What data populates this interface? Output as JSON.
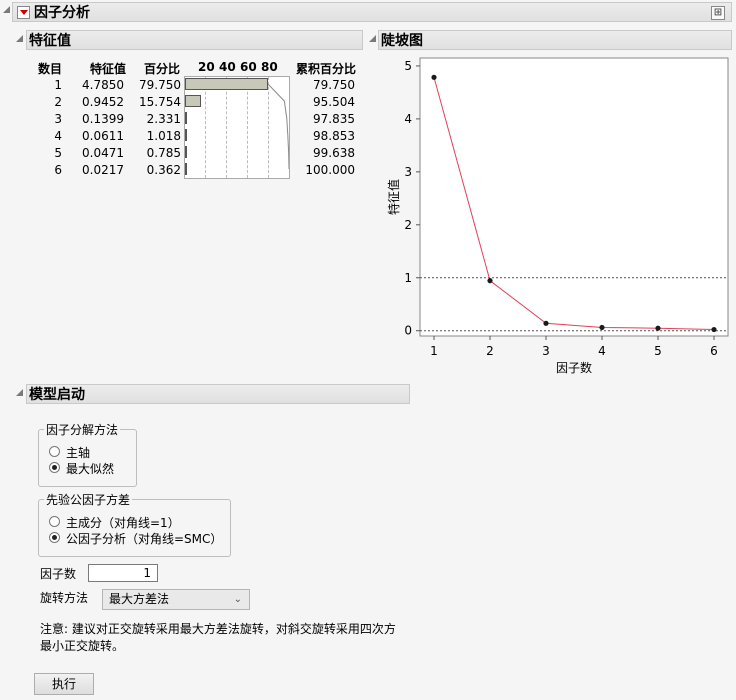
{
  "report": {
    "title": "因子分析"
  },
  "eigen": {
    "title": "特征值",
    "headers": {
      "number": "数目",
      "eigenvalue": "特征值",
      "percent": "百分比",
      "cumulative": "累积百分比"
    },
    "scale_ticks": [
      "20",
      "40",
      "60",
      "80"
    ],
    "rows": [
      {
        "number": "1",
        "eigenvalue": "4.7850",
        "percent": "79.750",
        "cumulative": "79.750",
        "pct_value": 79.75
      },
      {
        "number": "2",
        "eigenvalue": "0.9452",
        "percent": "15.754",
        "cumulative": "95.504",
        "pct_value": 15.754
      },
      {
        "number": "3",
        "eigenvalue": "0.1399",
        "percent": "2.331",
        "cumulative": "97.835",
        "pct_value": 2.331
      },
      {
        "number": "4",
        "eigenvalue": "0.0611",
        "percent": "1.018",
        "cumulative": "98.853",
        "pct_value": 1.018
      },
      {
        "number": "5",
        "eigenvalue": "0.0471",
        "percent": "0.785",
        "cumulative": "99.638",
        "pct_value": 0.785
      },
      {
        "number": "6",
        "eigenvalue": "0.0217",
        "percent": "0.362",
        "cumulative": "100.000",
        "pct_value": 0.362
      }
    ]
  },
  "scree": {
    "title": "陡坡图"
  },
  "chart_data": {
    "type": "line",
    "xlabel": "因子数",
    "ylabel": "特征值",
    "x": [
      1,
      2,
      3,
      4,
      5,
      6
    ],
    "series": [
      {
        "values": [
          4.785,
          0.9452,
          0.1399,
          0.0611,
          0.0471,
          0.0217
        ]
      }
    ],
    "xlim": [
      0.75,
      6.25
    ],
    "ylim": [
      -0.1,
      5.15
    ],
    "x_ticks": [
      "1",
      "2",
      "3",
      "4",
      "5",
      "6"
    ],
    "y_ticks": [
      "0",
      "1",
      "2",
      "3",
      "4",
      "5"
    ],
    "reference_lines": [
      0,
      1
    ],
    "line_color": "#e0405a",
    "grid": false
  },
  "model": {
    "title": "模型启动",
    "method_group": {
      "title": "因子分解方法",
      "options": [
        "主轴",
        "最大似然"
      ],
      "selected": 1
    },
    "prior_group": {
      "title": "先验公因子方差",
      "options": [
        "主成分（对角线=1）",
        "公因子分析（对角线=SMC）"
      ],
      "selected": 1
    },
    "factors_label": "因子数",
    "factors_value": "1",
    "rotation_label": "旋转方法",
    "rotation_value": "最大方差法",
    "note_line1": "注意: 建议对正交旋转采用最大方差法旋转，对斜交旋转采用四次方",
    "note_line2": "最小正交旋转。",
    "run_label": "执行"
  }
}
